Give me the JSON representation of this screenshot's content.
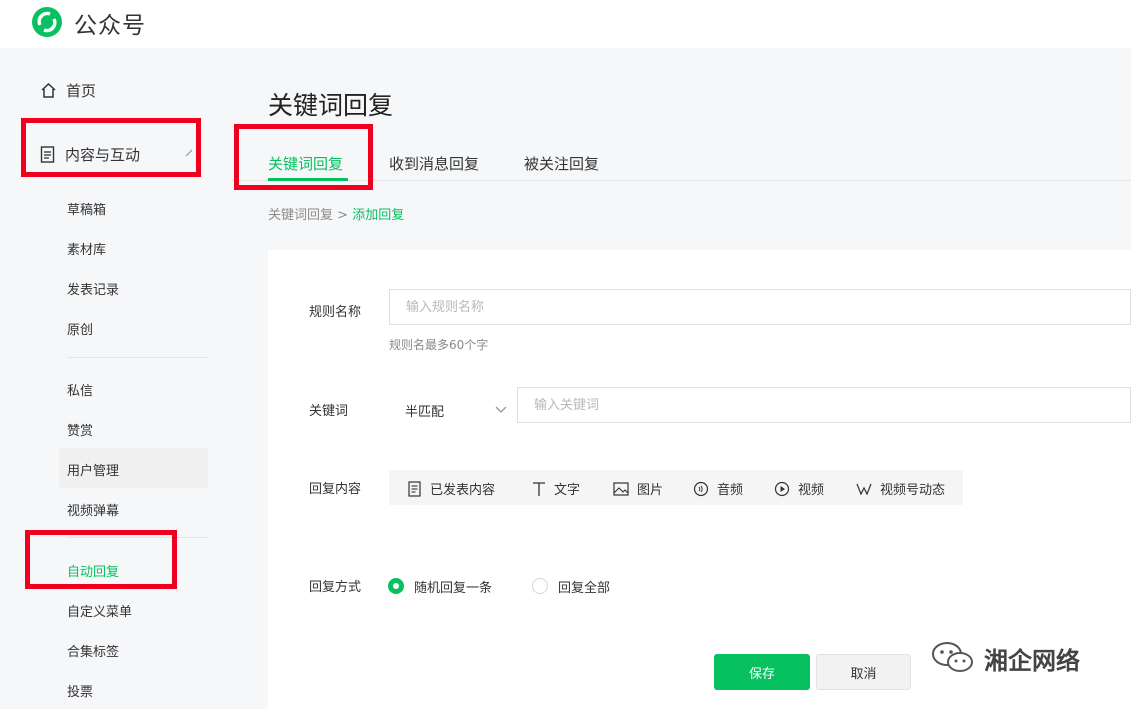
{
  "header": {
    "brand": "公众号",
    "brand_color": "#07c160"
  },
  "sidebar": {
    "home": "首页",
    "group": "内容与互动",
    "items": [
      {
        "label": "草稿箱"
      },
      {
        "label": "素材库"
      },
      {
        "label": "发表记录"
      },
      {
        "label": "原创"
      },
      {
        "label": "私信"
      },
      {
        "label": "赞赏"
      },
      {
        "label": "用户管理"
      },
      {
        "label": "视频弹幕"
      },
      {
        "label": "自动回复",
        "active": true
      },
      {
        "label": "自定义菜单"
      },
      {
        "label": "合集标签"
      },
      {
        "label": "投票"
      }
    ]
  },
  "main": {
    "title": "关键词回复",
    "tabs": [
      {
        "label": "关键词回复",
        "active": true
      },
      {
        "label": "收到消息回复"
      },
      {
        "label": "被关注回复"
      }
    ],
    "breadcrumb": {
      "parent": "关键词回复",
      "separator": ">",
      "current": "添加回复"
    },
    "form": {
      "rule_name_label": "规则名称",
      "rule_name_placeholder": "输入规则名称",
      "rule_name_hint": "规则名最多60个字",
      "keyword_label": "关键词",
      "match_mode": "半匹配",
      "keyword_placeholder": "输入关键词",
      "reply_content_label": "回复内容",
      "reply_types": [
        {
          "label": "已发表内容",
          "icon": "document-icon"
        },
        {
          "label": "文字",
          "icon": "text-icon"
        },
        {
          "label": "图片",
          "icon": "image-icon"
        },
        {
          "label": "音频",
          "icon": "audio-icon"
        },
        {
          "label": "视频",
          "icon": "video-icon"
        },
        {
          "label": "视频号动态",
          "icon": "channels-icon"
        }
      ],
      "reply_mode_label": "回复方式",
      "reply_modes": [
        {
          "label": "随机回复一条",
          "selected": true
        },
        {
          "label": "回复全部",
          "selected": false
        }
      ],
      "save": "保存",
      "cancel": "取消"
    }
  },
  "watermark": {
    "text": "湘企网络"
  },
  "annotation_color": "#f0001e"
}
